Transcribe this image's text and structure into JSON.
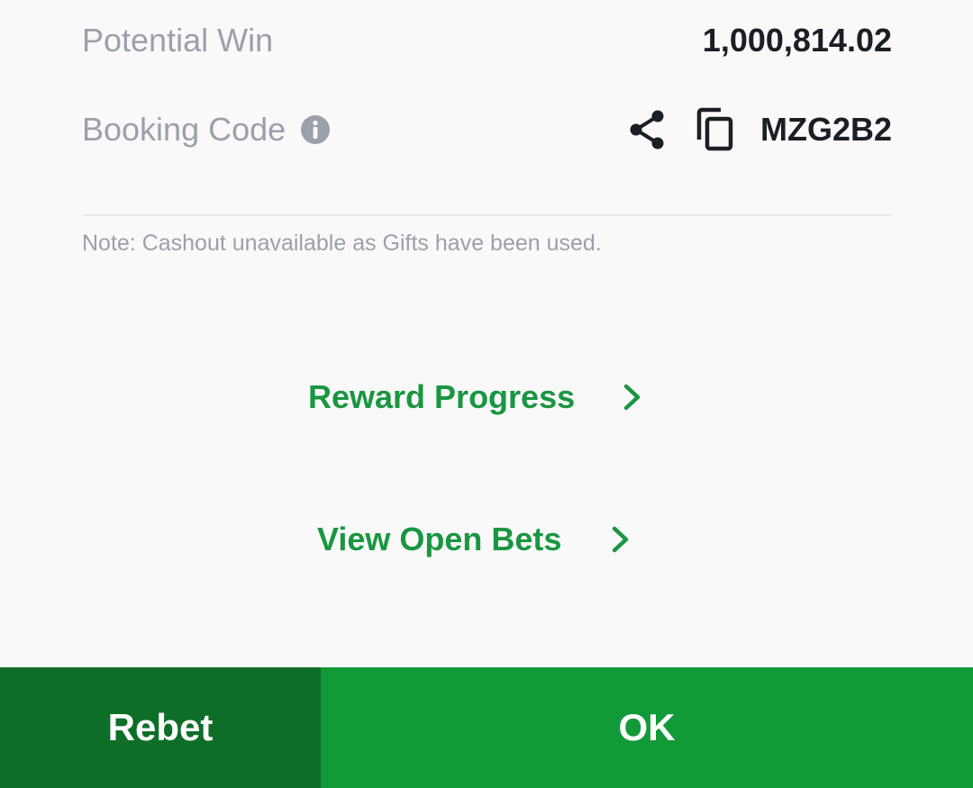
{
  "summary": {
    "potential_win_label": "Potential Win",
    "potential_win_value": "1,000,814.02",
    "booking_code_label": "Booking Code",
    "booking_code_value": "MZG2B2",
    "note": "Note: Cashout unavailable as Gifts have been used."
  },
  "links": {
    "reward_progress": "Reward Progress",
    "view_open_bets": "View Open Bets"
  },
  "footer": {
    "rebet_label": "Rebet",
    "ok_label": "OK"
  },
  "icons": {
    "info": "info-icon",
    "share": "share-icon",
    "copy": "copy-icon",
    "chevron": "chevron-right-icon"
  },
  "colors": {
    "accent_green": "#129a38",
    "dark_green": "#0e6e28",
    "link_green": "#1a9640",
    "muted_text": "#9ca0ab",
    "primary_text": "#1b1e25"
  }
}
